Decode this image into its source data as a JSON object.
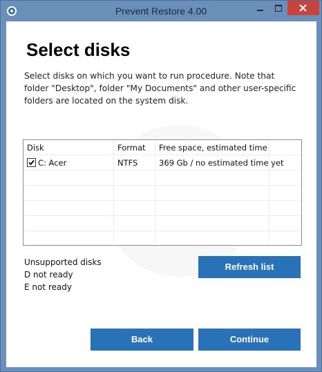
{
  "window": {
    "title": "Prevent Restore 4.00",
    "accent_color": "#6a8fb8",
    "close_color": "#c7433b"
  },
  "page": {
    "heading": "Select disks",
    "description": "Select disks on which you want to run procedure. Note that folder \"Desktop\", folder \"My Documents\" and other user-specific folders are located on the system disk."
  },
  "disk_table": {
    "columns": [
      "Disk",
      "Format",
      "Free space, estimated time"
    ],
    "rows": [
      {
        "checked": true,
        "disk": "C: Acer",
        "format": "NTFS",
        "free_space": "369 Gb / no estimated time yet"
      }
    ]
  },
  "unsupported": {
    "heading": "Unsupported disks",
    "items": [
      "D not ready",
      "E not ready"
    ]
  },
  "buttons": {
    "refresh": "Refresh list",
    "back": "Back",
    "continue": "Continue",
    "color": "#2a72b8"
  },
  "icons": {
    "app": "app-icon",
    "minimize": "minimize-icon",
    "maximize": "maximize-icon",
    "close": "close-icon",
    "check": "checkmark-icon"
  }
}
